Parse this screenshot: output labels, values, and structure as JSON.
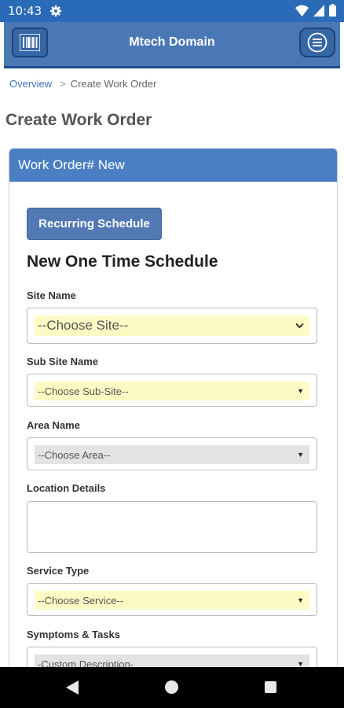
{
  "status_bar": {
    "time": "10:43",
    "icons": [
      "gear-icon",
      "wifi-icon",
      "signal-icon",
      "battery-icon"
    ]
  },
  "app_bar": {
    "title": "Mtech Domain",
    "left_icon": "barcode-icon",
    "right_icon": "menu-icon"
  },
  "breadcrumb": {
    "overview": "Overview",
    "separator": ">",
    "current": "Create Work Order"
  },
  "page": {
    "title": "Create Work Order"
  },
  "panel": {
    "header": "Work Order# New",
    "recurring_button": "Recurring Schedule",
    "section_title": "New One Time Schedule"
  },
  "form": {
    "site": {
      "label": "Site Name",
      "value": "--Choose Site--"
    },
    "sub_site": {
      "label": "Sub Site Name",
      "value": "--Choose Sub-Site--"
    },
    "area": {
      "label": "Area Name",
      "value": "--Choose Area--"
    },
    "location": {
      "label": "Location Details",
      "value": ""
    },
    "service": {
      "label": "Service Type",
      "value": "--Choose Service--"
    },
    "symptoms": {
      "label": "Symptoms & Tasks",
      "value": "-Custom Description-"
    }
  },
  "colors": {
    "status_bar": "#2a6bb8",
    "app_bar": "#4a78b5",
    "panel_header": "#4a7fc3",
    "select_highlight": "#fdfbc4",
    "select_disabled": "#e3e3e3"
  },
  "nav_bar": {
    "icons": [
      "back-icon",
      "home-icon",
      "recents-icon"
    ]
  }
}
